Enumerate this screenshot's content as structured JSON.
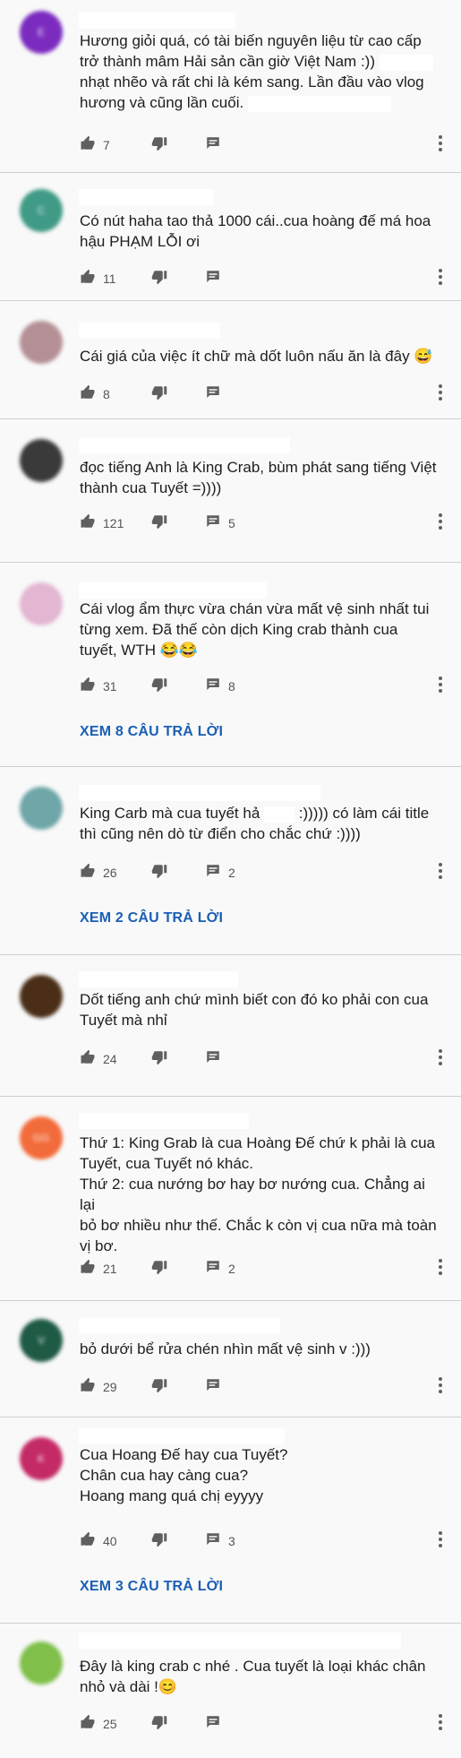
{
  "comments": [
    {
      "avatar_color": "#7b2cbf",
      "avatar_letter": "E",
      "lines": [
        "Hương giỏi quá, có tài biến nguyên liệu từ cao cấp",
        "trở thành mâm Hải sản cần giờ Việt Nam :))",
        "nhạt nhẽo và rất chi là kém sang. Lần đầu vào vlog",
        "hương và cũng lần cuối."
      ],
      "likes": "7",
      "replies": "",
      "view_replies": ""
    },
    {
      "avatar_color": "#3f9a86",
      "avatar_letter": "C",
      "lines": [
        "Có nút haha tao thả 1000 cái..cua hoàng đế má hoa",
        "hậu PHẠM LỖI ơi"
      ],
      "likes": "11",
      "replies": "",
      "view_replies": ""
    },
    {
      "avatar_color": "#b58f96",
      "avatar_letter": "",
      "lines": [
        "Cái giá của việc ít chữ mà dốt luôn nấu ăn là đây 😅"
      ],
      "likes": "8",
      "replies": "",
      "view_replies": ""
    },
    {
      "avatar_color": "#3a3a3a",
      "avatar_letter": "",
      "lines": [
        "đọc tiếng Anh là King Crab, bùm phát sang tiếng Việt",
        "thành cua Tuyết =))))"
      ],
      "likes": "121",
      "replies": "5",
      "view_replies": ""
    },
    {
      "avatar_color": "#e3b6d1",
      "avatar_letter": "",
      "lines": [
        "Cái vlog ẩm thực vừa chán vừa mất vệ sinh nhất tui",
        "từng xem. Đã thế còn dịch King crab thành cua",
        "tuyết, WTH 😂😂"
      ],
      "likes": "31",
      "replies": "8",
      "view_replies": "XEM 8 CÂU TRẢ LỜI"
    },
    {
      "avatar_color": "#6fa6a8",
      "avatar_letter": "",
      "lines": [
        "King Carb mà cua tuyết hả :))))) có làm cái title",
        "thì cũng nên dò từ điển cho chắc chứ :))))"
      ],
      "likes": "26",
      "replies": "2",
      "view_replies": "XEM 2 CÂU TRẢ LỜI"
    },
    {
      "avatar_color": "#4a2e17",
      "avatar_letter": "",
      "lines": [
        "Dốt tiếng anh chứ mình biết con đó ko phải con cua",
        "Tuyết mà nhỉ"
      ],
      "likes": "24",
      "replies": "",
      "view_replies": ""
    },
    {
      "avatar_color": "#f26b3a",
      "avatar_letter": "GG",
      "lines": [
        "Thứ 1: King Grab là cua Hoàng Đế chứ k phải là cua",
        "Tuyết, cua Tuyết nó khác.",
        "Thứ 2: cua nướng bơ hay bơ nướng cua. Chẳng ai lại",
        "bỏ bơ nhiều như thế. Chắc k còn vị cua nữa mà toàn",
        "vị bơ."
      ],
      "likes": "21",
      "replies": "2",
      "view_replies": ""
    },
    {
      "avatar_color": "#1f5a45",
      "avatar_letter": "V",
      "lines": [
        "bỏ dưới bể rửa chén nhìn mất vệ sinh v :)))"
      ],
      "likes": "29",
      "replies": "",
      "view_replies": ""
    },
    {
      "avatar_color": "#c42a66",
      "avatar_letter": "K",
      "lines": [
        "Cua Hoang Đế hay cua Tuyết?",
        "Chân cua hay càng cua?",
        "Hoang mang quá chị eyyyy"
      ],
      "likes": "40",
      "replies": "3",
      "view_replies": "XEM 3 CÂU TRẢ LỜI"
    },
    {
      "avatar_color": "#7fbf4a",
      "avatar_letter": "",
      "lines": [
        "Đây là king crab c nhé . Cua tuyết là loại khác chân",
        "nhỏ và dài !😊"
      ],
      "likes": "25",
      "replies": "",
      "view_replies": ""
    }
  ]
}
